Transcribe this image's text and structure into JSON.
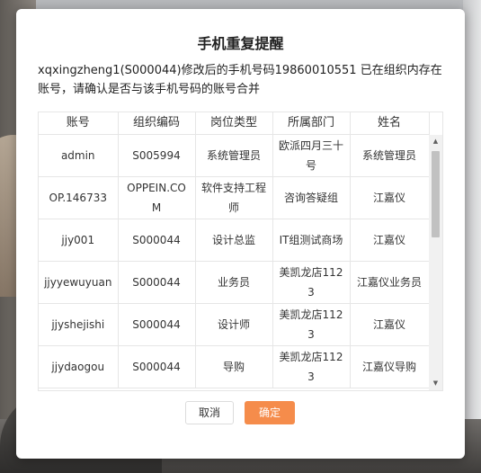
{
  "dialog": {
    "title": "手机重复提醒",
    "message": "xqxingzheng1(S000044)修改后的手机号码19860010551 已在组织内存在账号，请确认是否与该手机号码的账号合并",
    "cancel_label": "取消",
    "confirm_label": "确定"
  },
  "table": {
    "columns": [
      "账号",
      "组织编码",
      "岗位类型",
      "所属部门",
      "姓名"
    ],
    "rows": [
      [
        "admin",
        "S005994",
        "系统管理员",
        "欧派四月三十号",
        "系统管理员"
      ],
      [
        "OP.146733",
        "OPPEIN.COM",
        "软件支持工程师",
        "咨询答疑组",
        "江嘉仪"
      ],
      [
        "jjy001",
        "S000044",
        "设计总监",
        "IT组测试商场",
        "江嘉仪"
      ],
      [
        "jjyyewuyuan",
        "S000044",
        "业务员",
        "美凯龙店1123",
        "江嘉仪业务员"
      ],
      [
        "jjyshejishi",
        "S000044",
        "设计师",
        "美凯龙店1123",
        "江嘉仪"
      ],
      [
        "jjydaogou",
        "S000044",
        "导购",
        "美凯龙店1123",
        "江嘉仪导购"
      ]
    ]
  },
  "icons": {
    "scroll_up": "triangle-up-icon",
    "scroll_down": "triangle-down-icon"
  },
  "colors": {
    "confirm_button": "#f58c4b",
    "dialog_background": "#ffffff"
  }
}
